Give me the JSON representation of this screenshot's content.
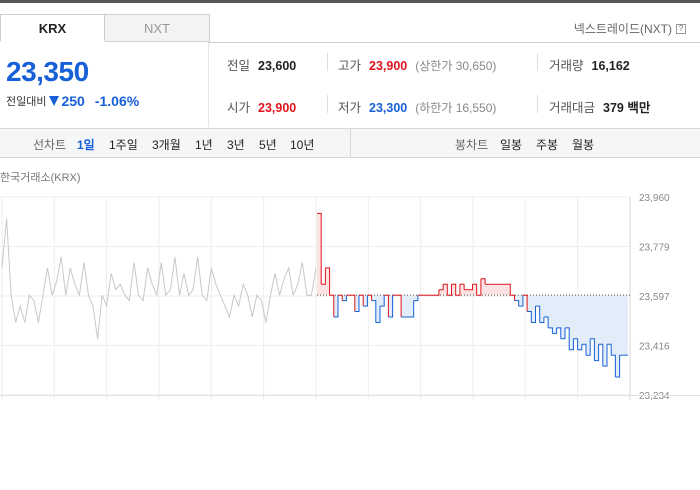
{
  "tabs": [
    {
      "label": "KRX",
      "active": true
    },
    {
      "label": "NXT",
      "active": false
    }
  ],
  "nxt_link": "넥스트레이드(NXT)",
  "help_icon": "question-icon",
  "price": "23,350",
  "change": {
    "label": "전일대비",
    "direction_icon": "down-triangle-icon",
    "value": "250",
    "percent": "-1.06%"
  },
  "stats": {
    "prev_close": {
      "label": "전일",
      "value": "23,600"
    },
    "high": {
      "label": "고가",
      "value": "23,900",
      "sub": "(상한가 30,650)"
    },
    "volume": {
      "label": "거래량",
      "value": "16,162"
    },
    "open": {
      "label": "시가",
      "value": "23,900"
    },
    "low": {
      "label": "저가",
      "value": "23,300",
      "sub": "(하한가 16,550)"
    },
    "amount": {
      "label": "거래대금",
      "value": "379 백만"
    }
  },
  "period_bar": {
    "line_label": "선차트",
    "line_options": [
      "1일",
      "1주일",
      "3개월",
      "1년",
      "3년",
      "5년",
      "10년"
    ],
    "selected": "1일",
    "candle_label": "봉차트",
    "candle_options": [
      "일봉",
      "주봉",
      "월봉"
    ]
  },
  "exchange_title": "한국거래소(KRX)",
  "colors": {
    "up": "#e0141e",
    "down": "#1760d8",
    "prev_day_line": "#c8c8c8"
  },
  "chart_data": {
    "type": "line",
    "y_ticks": [
      "23,960",
      "23,779",
      "23,597",
      "23,416",
      "23,234"
    ],
    "ylim": [
      23234,
      23960
    ],
    "baseline": 23600,
    "baseline_style": "dotted",
    "grid": true,
    "x_gridlines": 13,
    "series": [
      {
        "role": "previous-session",
        "color": "#c8c8c8",
        "values": [
          23700,
          23880,
          23600,
          23500,
          23560,
          23500,
          23600,
          23580,
          23500,
          23600,
          23700,
          23600,
          23650,
          23740,
          23600,
          23700,
          23640,
          23600,
          23720,
          23600,
          23560,
          23440,
          23600,
          23560,
          23680,
          23620,
          23640,
          23600,
          23580,
          23720,
          23600,
          23580,
          23700,
          23640,
          23600,
          23720,
          23600,
          23620,
          23740,
          23600,
          23680,
          23600,
          23620,
          23740,
          23600,
          23580,
          23700,
          23640,
          23600,
          23560,
          23520,
          23600,
          23560,
          23640,
          23600,
          23520,
          23600,
          23580,
          23500,
          23600,
          23680,
          23600,
          23660,
          23700,
          23600,
          23640,
          23720,
          23600,
          23600,
          23700
        ]
      },
      {
        "role": "today",
        "values": [
          23900,
          23640,
          23700,
          23600,
          23520,
          23600,
          23580,
          23600,
          23600,
          23540,
          23600,
          23560,
          23600,
          23580,
          23500,
          23560,
          23600,
          23520,
          23600,
          23600,
          23520,
          23520,
          23520,
          23580,
          23600,
          23600,
          23600,
          23600,
          23600,
          23620,
          23640,
          23600,
          23640,
          23600,
          23640,
          23620,
          23620,
          23640,
          23600,
          23660,
          23640,
          23640,
          23640,
          23640,
          23640,
          23640,
          23600,
          23580,
          23560,
          23600,
          23540,
          23500,
          23560,
          23500,
          23520,
          23480,
          23460,
          23480,
          23440,
          23480,
          23400,
          23440,
          23400,
          23420,
          23380,
          23440,
          23360,
          23420,
          23340,
          23420,
          23380,
          23300,
          23380,
          23380,
          23380
        ]
      }
    ]
  }
}
